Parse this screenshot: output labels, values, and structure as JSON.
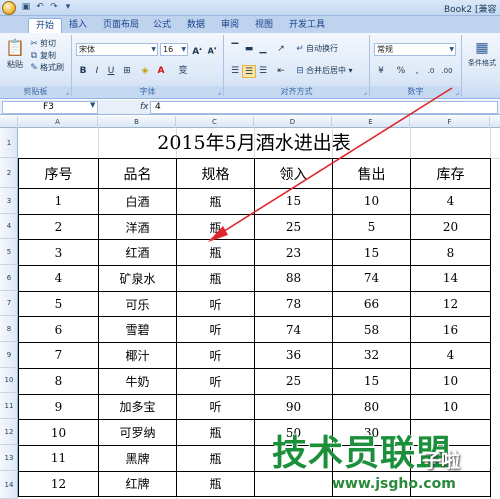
{
  "titlebar": {
    "book_title": "Book2 [兼容"
  },
  "tabs": [
    "开始",
    "插入",
    "页面布局",
    "公式",
    "数据",
    "审阅",
    "视图",
    "开发工具"
  ],
  "ribbon": {
    "paste": "粘贴",
    "cut": "剪切",
    "copy": "复制",
    "format_painter": "格式刷",
    "clipboard_label": "剪贴板",
    "font_name": "宋体",
    "font_size": "16",
    "font_label": "字体",
    "wrap_text": "自动换行",
    "merge_center": "合并后居中",
    "alignment_label": "对齐方式",
    "number_format": "常规",
    "number_label": "数字",
    "conditional_format": "条件格式"
  },
  "formula_bar": {
    "cell_ref": "F3",
    "formula": "4"
  },
  "columns": [
    "A",
    "B",
    "C",
    "D",
    "E",
    "F"
  ],
  "rows": [
    "1",
    "2",
    "3",
    "4",
    "5",
    "6",
    "7",
    "8",
    "9",
    "10",
    "11",
    "12",
    "13",
    "14"
  ],
  "sheet": {
    "title": "2015年5月酒水进出表",
    "headers": [
      "序号",
      "品名",
      "规格",
      "领入",
      "售出",
      "库存"
    ],
    "data": [
      [
        "1",
        "白酒",
        "瓶",
        "15",
        "10",
        "4"
      ],
      [
        "2",
        "洋酒",
        "瓶",
        "25",
        "5",
        "20"
      ],
      [
        "3",
        "红酒",
        "瓶",
        "23",
        "15",
        "8"
      ],
      [
        "4",
        "矿泉水",
        "瓶",
        "88",
        "74",
        "14"
      ],
      [
        "5",
        "可乐",
        "听",
        "78",
        "66",
        "12"
      ],
      [
        "6",
        "雪碧",
        "听",
        "74",
        "58",
        "16"
      ],
      [
        "7",
        "椰汁",
        "听",
        "36",
        "32",
        "4"
      ],
      [
        "8",
        "牛奶",
        "听",
        "25",
        "15",
        "10"
      ],
      [
        "9",
        "加多宝",
        "听",
        "90",
        "80",
        "10"
      ],
      [
        "10",
        "可罗纳",
        "瓶",
        "50",
        "30",
        ""
      ],
      [
        "11",
        "黑牌",
        "瓶",
        "",
        "",
        ""
      ],
      [
        "12",
        "红牌",
        "瓶",
        "",
        "",
        ""
      ]
    ]
  },
  "watermark": {
    "main": "技术员联盟",
    "side": "子啦",
    "url": "www.jsgho.com"
  },
  "colors": {
    "arrow": "#e0262b",
    "watermark_green": "#1b8f3a"
  }
}
